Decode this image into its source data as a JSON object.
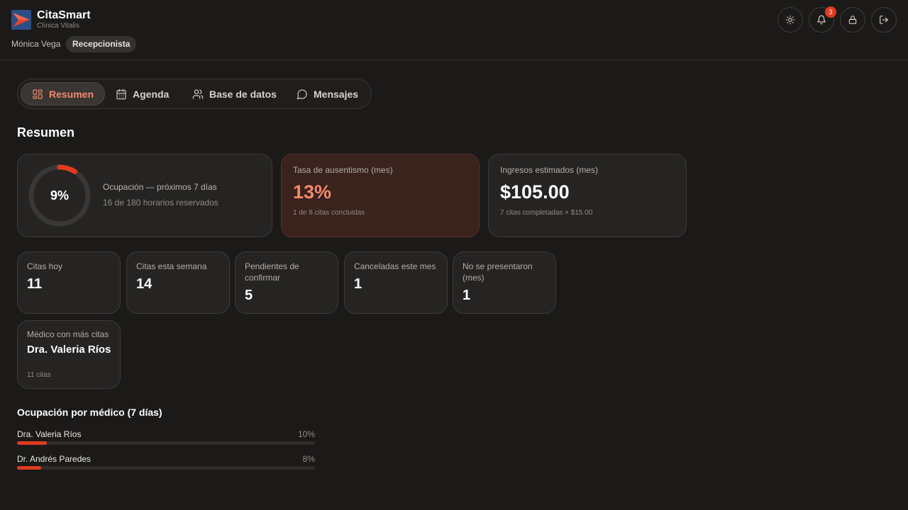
{
  "app": {
    "name": "CitaSmart",
    "clinic": "Clínica Vitalis",
    "user": "Mónica Vega",
    "role": "Recepcionista",
    "notifications": "3"
  },
  "nav": {
    "tabs": [
      {
        "label": "Resumen",
        "icon": "dashboard-icon",
        "active": true
      },
      {
        "label": "Agenda",
        "icon": "calendar-icon",
        "active": false
      },
      {
        "label": "Base de datos",
        "icon": "users-icon",
        "active": false
      },
      {
        "label": "Mensajes",
        "icon": "message-icon",
        "active": false
      }
    ]
  },
  "page": {
    "title": "Resumen"
  },
  "occupancy": {
    "value": "9%",
    "fraction": 0.09,
    "title": "Ocupación — próximos 7 días",
    "subtitle": "16 de 180 horarios reservados"
  },
  "absence": {
    "label": "Tasa de ausentismo (mes)",
    "value": "13%",
    "note": "1 de 8 citas concluidas"
  },
  "income": {
    "label": "Ingresos estimados (mes)",
    "value": "$105.00",
    "note": "7 citas completadas × $15.00"
  },
  "stats": [
    {
      "label": "Citas hoy",
      "value": "11"
    },
    {
      "label": "Citas esta semana",
      "value": "14"
    },
    {
      "label": "Pendientes de confirmar",
      "value": "5"
    },
    {
      "label": "Canceladas este mes",
      "value": "1"
    },
    {
      "label": "No se presentaron (mes)",
      "value": "1"
    }
  ],
  "top_doctor": {
    "label": "Médico con más citas",
    "name": "Dra. Valeria Ríos",
    "count": "11 citas"
  },
  "doctor_occupancy": {
    "title": "Ocupación por médico (7 días)",
    "rows": [
      {
        "name": "Dra. Valeria Ríos",
        "percent": "10%",
        "fraction": 0.1
      },
      {
        "name": "Dr. Andrés Paredes",
        "percent": "8%",
        "fraction": 0.08
      }
    ]
  },
  "colors": {
    "accent": "#e03b1f",
    "accent_text": "#f28a6c",
    "background": "#1b1a19"
  }
}
